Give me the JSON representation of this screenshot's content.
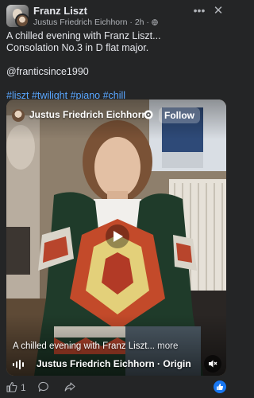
{
  "post": {
    "author": "Franz Liszt",
    "shared_by": "Justus Friedrich Eichhorn",
    "time": "2h",
    "separator": "·",
    "caption": {
      "line1": "A chilled evening with Franz Liszt...",
      "line2": "Consolation No.3 in D flat major.",
      "mention": "@franticsince1990",
      "hashtags": "#liszt #twilight #piano #chill"
    }
  },
  "video": {
    "creator_name": "Justus Friedrich Eichhorn",
    "follow_label": "Follow",
    "caption_text": "A chilled evening with Franz Liszt...",
    "more_label": " more",
    "audio_label": "Justus Friedrich Eichhorn · Origin"
  },
  "footer": {
    "like_count": "1"
  },
  "icons": {
    "menu": "more-horizontal-icon",
    "close": "close-icon",
    "globe": "globe-icon",
    "verified": "verified-badge-icon",
    "play": "play-icon",
    "audio": "audio-wave-icon",
    "mute": "mute-icon",
    "like": "like-icon",
    "comment": "comment-icon",
    "share": "share-icon"
  },
  "colors": {
    "background": "#242526",
    "text_primary": "#e4e6eb",
    "text_secondary": "#b0b3b8",
    "link": "#5aa7ff",
    "accent": "#1877f2"
  }
}
